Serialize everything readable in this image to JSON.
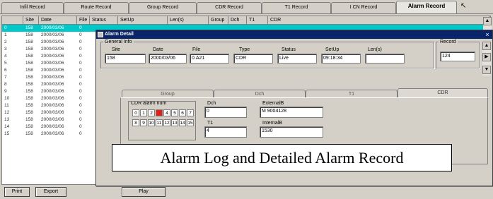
{
  "tabs": [
    "Infil Record",
    "Route Record",
    "Group Record",
    "CDR Record",
    "T1 Record",
    "I CN Record",
    "Alarm Record"
  ],
  "list": {
    "columns": [
      "",
      "Site",
      "Date",
      "File",
      "Status",
      "SetUp",
      "Len(s)",
      "Group",
      "Dch",
      "T1",
      "CDR"
    ],
    "rows": [
      [
        "0",
        "158",
        "2000/03/06",
        "0"
      ],
      [
        "1",
        "158",
        "2000/03/06",
        "0"
      ],
      [
        "2",
        "158",
        "2000/03/06",
        "0"
      ],
      [
        "3",
        "158",
        "2000/03/06",
        "0"
      ],
      [
        "4",
        "158",
        "2000/03/06",
        "0"
      ],
      [
        "5",
        "158",
        "2000/03/06",
        "0"
      ],
      [
        "6",
        "158",
        "2000/03/06",
        "0"
      ],
      [
        "7",
        "158",
        "2000/03/06",
        "0"
      ],
      [
        "8",
        "158",
        "2000/03/06",
        "0"
      ],
      [
        "9",
        "158",
        "2000/03/06",
        "0"
      ],
      [
        "10",
        "158",
        "2000/03/06",
        "0"
      ],
      [
        "11",
        "158",
        "2000/03/06",
        "0"
      ],
      [
        "12",
        "158",
        "2000/03/06",
        "0"
      ],
      [
        "13",
        "158",
        "2000/03/06",
        "0"
      ],
      [
        "14",
        "158",
        "2000/03/06",
        "0"
      ],
      [
        "15",
        "158",
        "2000/03/06",
        "0"
      ]
    ]
  },
  "buttons": {
    "print": "Print",
    "export": "Export",
    "play": "Play"
  },
  "dialog": {
    "title": "Alarm Detail",
    "general_label": "General Info",
    "record_label": "Record",
    "fields": [
      {
        "label": "Site",
        "value": "158"
      },
      {
        "label": "Date",
        "value": "2000/03/06"
      },
      {
        "label": "File",
        "value": "0.A21"
      },
      {
        "label": "Type",
        "value": "CDR"
      },
      {
        "label": "Status",
        "value": "Live"
      },
      {
        "label": "SetUp",
        "value": "09:18:34"
      },
      {
        "label": "Len(s)",
        "value": ""
      }
    ],
    "record_value": "124",
    "inner_tabs": [
      "Group",
      "Dch",
      "T1",
      "CDR"
    ],
    "alarm_num_label": "CDR alarm num",
    "digits_row1": [
      "0",
      "1",
      "2",
      "3",
      "4",
      "5",
      "6",
      "7"
    ],
    "digits_row2": [
      "8",
      "9",
      "10",
      "11",
      "12",
      "13",
      "14",
      "15"
    ],
    "on_digit": "3",
    "dch_label": "Dch",
    "dch_value": "0",
    "t1_label": "T1",
    "t1_value": "4",
    "external_label": "ExternalB",
    "external_value": "M 9004128",
    "internal_label": "InternalB",
    "internal_value": "1530"
  },
  "caption": "Alarm Log and Detailed Alarm Record"
}
